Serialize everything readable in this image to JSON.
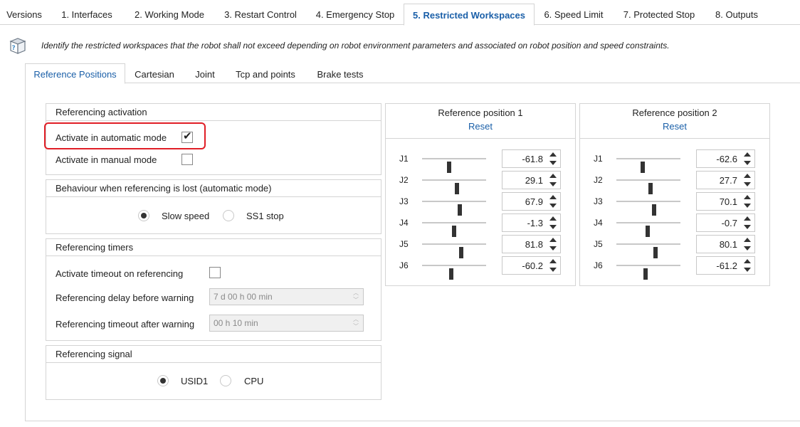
{
  "top_tabs": [
    {
      "label": "Versions",
      "active": false
    },
    {
      "label": "1. Interfaces",
      "active": false
    },
    {
      "label": "2. Working Mode",
      "active": false
    },
    {
      "label": "3. Restart Control",
      "active": false
    },
    {
      "label": "4. Emergency Stop",
      "active": false
    },
    {
      "label": "5. Restricted Workspaces",
      "active": true
    },
    {
      "label": "6. Speed Limit",
      "active": false
    },
    {
      "label": "7. Protected Stop",
      "active": false
    },
    {
      "label": "8. Outputs",
      "active": false
    }
  ],
  "info": {
    "icon": "help-book-icon",
    "text": "Identify the restricted workspaces that the robot shall not exceed depending on robot environment parameters and associated on robot position and speed constraints."
  },
  "sub_tabs": [
    {
      "label": "Reference Positions",
      "active": true
    },
    {
      "label": "Cartesian",
      "active": false
    },
    {
      "label": "Joint",
      "active": false
    },
    {
      "label": "Tcp and points",
      "active": false
    },
    {
      "label": "Brake tests",
      "active": false
    }
  ],
  "activation": {
    "title": "Referencing activation",
    "auto_label": "Activate in automatic mode",
    "auto_checked": true,
    "manual_label": "Activate in manual mode",
    "manual_checked": false
  },
  "behaviour": {
    "title": "Behaviour when referencing is lost (automatic mode)",
    "options": [
      {
        "label": "Slow speed",
        "checked": true
      },
      {
        "label": "SS1 stop",
        "checked": false
      }
    ]
  },
  "timers": {
    "title": "Referencing timers",
    "timeout_label": "Activate timeout on referencing",
    "timeout_checked": false,
    "delay_label": "Referencing delay before warning",
    "delay_value": "7 d 00 h 00 min",
    "after_label": "Referencing timeout after warning",
    "after_value": "00 h 10 min"
  },
  "signal": {
    "title": "Referencing signal",
    "options": [
      {
        "label": "USID1",
        "checked": true
      },
      {
        "label": "CPU",
        "checked": false
      }
    ]
  },
  "ref_positions": [
    {
      "title": "Reference position 1",
      "reset_label": "Reset",
      "joints": [
        {
          "name": "J1",
          "value": "-61.8",
          "slider": 0.42
        },
        {
          "name": "J2",
          "value": "29.1",
          "slider": 0.54
        },
        {
          "name": "J3",
          "value": "67.9",
          "slider": 0.59
        },
        {
          "name": "J4",
          "value": "-1.3",
          "slider": 0.5
        },
        {
          "name": "J5",
          "value": "81.8",
          "slider": 0.61
        },
        {
          "name": "J6",
          "value": "-60.2",
          "slider": 0.46
        }
      ]
    },
    {
      "title": "Reference position 2",
      "reset_label": "Reset",
      "joints": [
        {
          "name": "J1",
          "value": "-62.6",
          "slider": 0.41
        },
        {
          "name": "J2",
          "value": "27.7",
          "slider": 0.53
        },
        {
          "name": "J3",
          "value": "70.1",
          "slider": 0.59
        },
        {
          "name": "J4",
          "value": "-0.7",
          "slider": 0.49
        },
        {
          "name": "J5",
          "value": "80.1",
          "slider": 0.61
        },
        {
          "name": "J6",
          "value": "-61.2",
          "slider": 0.45
        }
      ]
    }
  ],
  "colors": {
    "accent": "#1a5fa8",
    "highlight": "#e01e26",
    "border": "#d4d4d4"
  }
}
